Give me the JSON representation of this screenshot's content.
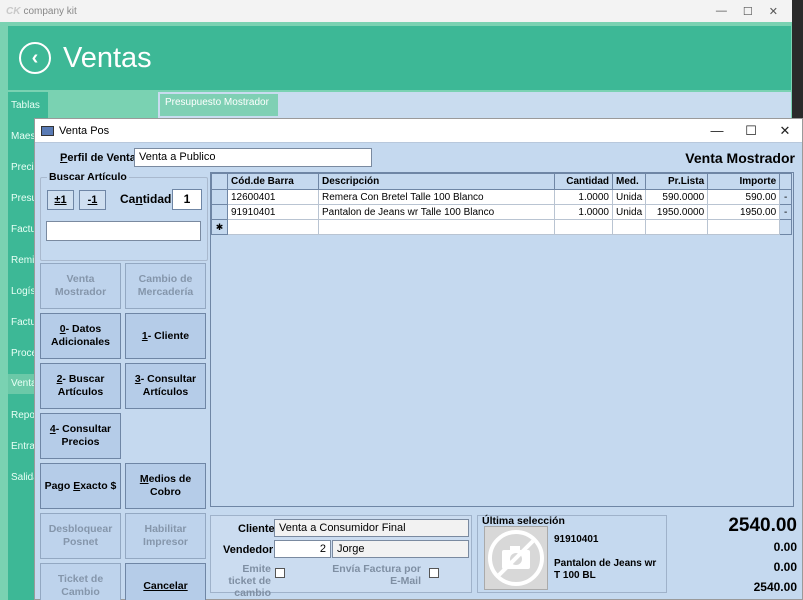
{
  "bg": {
    "app_title": "company kit",
    "app_logo": "CK",
    "header_title": "Ventas",
    "sidebar": [
      "Tablas",
      "Maes",
      "Preci",
      "Presu",
      "Factu",
      "Remit",
      "Logís",
      "Factu",
      "Proce",
      "Venta",
      "Repo",
      "Entra",
      "Salida"
    ],
    "tab": "Presupuesto Mostrador"
  },
  "window": {
    "title": "Venta Pos",
    "min": "—",
    "max": "☐",
    "close": "✕"
  },
  "perfil": {
    "label_prefix": "P",
    "label_rest": "erfil de Venta",
    "value": "Venta a Publico"
  },
  "mostrador_title": "Venta Mostrador",
  "buscar": {
    "legend": "Buscar Artículo",
    "plus": "±1",
    "minus": "-1",
    "cantidad_prefix": "Ca",
    "cantidad_ul": "n",
    "cantidad_rest": "tidad",
    "cantidad_value": "1",
    "search_value": ""
  },
  "buttons": {
    "venta_mostrador": "Venta Mostrador",
    "cambio_mercaderia": "Cambio de Mercadería",
    "datos_key": "0",
    "datos_rest": "- Datos Adicionales",
    "cliente_key": "1",
    "cliente_rest": "- Cliente",
    "buscar_key": "2",
    "buscar_rest": "- Buscar Artículos",
    "consultar_key": "3",
    "consultar_rest": "- Consultar Artículos",
    "precios_key": "4",
    "precios_rest": "- Consultar Precios",
    "pago_a": "Pago ",
    "pago_ul": "E",
    "pago_b": "xacto $",
    "medios_ul": "M",
    "medios_rest": "edios de Cobro",
    "desbloquear": "Desbloquear Posnet",
    "habilitar": "Habilitar Impresor",
    "ticket": "Ticket de Cambio",
    "cancelar": "Cancelar"
  },
  "grid": {
    "headers": [
      "Cód.de Barra",
      "Descripción",
      "Cantidad",
      "Med.",
      "Pr.Lista",
      "Importe"
    ],
    "rows": [
      [
        "12600401",
        "Remera Con Bretel  Talle 100 Blanco",
        "1.0000",
        "Unida",
        "590.0000",
        "590.00"
      ],
      [
        "91910401",
        "Pantalon de Jeans wr Talle 100 Blanco",
        "1.0000",
        "Unida",
        "1950.0000",
        "1950.00"
      ]
    ],
    "new_row_marker": "✱",
    "row_button": "-"
  },
  "client": {
    "cliente_label": "Cliente",
    "cliente_value": "Venta a Consumidor Final",
    "vendedor_label": "Vendedor",
    "vendedor_code": "2",
    "vendedor_name": "Jorge",
    "emite_ticket": "Emite ticket de cambio",
    "envia_factura": "Envía Factura por E-Mail"
  },
  "last_selection": {
    "title": "Última selección",
    "code": "91910401",
    "description": "Pantalon de Jeans wr T 100 BL"
  },
  "totals": {
    "total": "2540.00",
    "line2": "0.00",
    "line3": "0.00",
    "line4": "2540.00"
  }
}
